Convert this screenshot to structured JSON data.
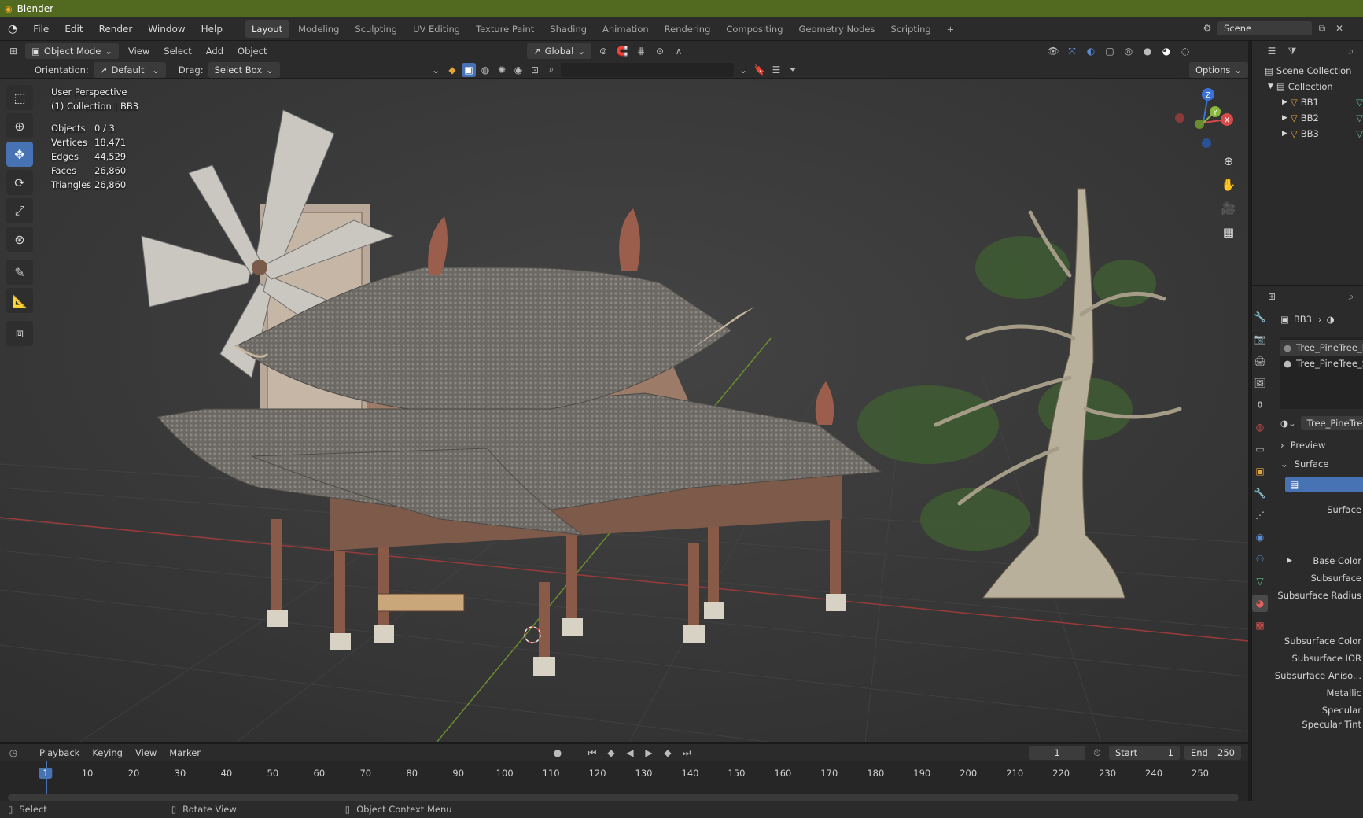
{
  "app_title": "Blender",
  "menus": [
    "File",
    "Edit",
    "Render",
    "Window",
    "Help"
  ],
  "workspaces": [
    "Layout",
    "Modeling",
    "Sculpting",
    "UV Editing",
    "Texture Paint",
    "Shading",
    "Animation",
    "Rendering",
    "Compositing",
    "Geometry Nodes",
    "Scripting"
  ],
  "active_workspace": "Layout",
  "add_workspace": "+",
  "scene_name": "Scene",
  "viewport_header": {
    "mode": "Object Mode",
    "menus": [
      "View",
      "Select",
      "Add",
      "Object"
    ],
    "transform_orientation": "Global",
    "orientation_label": "Orientation:",
    "orientation_value": "Default",
    "drag_label": "Drag:",
    "drag_value": "Select Box",
    "options": "Options"
  },
  "overlay": {
    "view_name": "User Perspective",
    "collection_line": "(1) Collection | BB3",
    "stats": [
      {
        "label": "Objects",
        "value": "0 / 3"
      },
      {
        "label": "Vertices",
        "value": "18,471"
      },
      {
        "label": "Edges",
        "value": "44,529"
      },
      {
        "label": "Faces",
        "value": "26,860"
      },
      {
        "label": "Triangles",
        "value": "26,860"
      }
    ]
  },
  "gizmo_labels": {
    "z": "Z",
    "y": "Y",
    "x": "X"
  },
  "outliner": {
    "root": "Scene Collection",
    "collection": "Collection",
    "objects": [
      "BB1",
      "BB2",
      "BB3"
    ]
  },
  "properties": {
    "object_name": "BB3",
    "material_slots": [
      "Tree_PineTree_l",
      "Tree_PineTree_S"
    ],
    "material_name": "Tree_PineTree",
    "panels": [
      "Preview",
      "Surface"
    ],
    "surface_label": "Surface",
    "inputs": [
      "Base Color",
      "Subsurface",
      "Subsurface Radius",
      "Subsurface Color",
      "Subsurface IOR",
      "Subsurface Aniso...",
      "Metallic",
      "Specular",
      "Specular Tint"
    ]
  },
  "timeline": {
    "menus": [
      "Playback",
      "Keying",
      "View",
      "Marker"
    ],
    "current_frame": "1",
    "start_label": "Start",
    "start_value": "1",
    "end_label": "End",
    "end_value": "250",
    "ticks": [
      "1",
      "10",
      "20",
      "30",
      "40",
      "50",
      "60",
      "70",
      "80",
      "90",
      "100",
      "110",
      "120",
      "130",
      "140",
      "150",
      "160",
      "170",
      "180",
      "190",
      "200",
      "210",
      "220",
      "230",
      "240",
      "250"
    ]
  },
  "status_bar": {
    "select": "Select",
    "rotate": "Rotate View",
    "context": "Object Context Menu"
  },
  "colors": {
    "titlebar": "#526a1f",
    "accent": "#4772b3",
    "x_axis": "#d84a4a",
    "y_axis": "#8ab83a",
    "z_axis": "#3a72d8"
  }
}
